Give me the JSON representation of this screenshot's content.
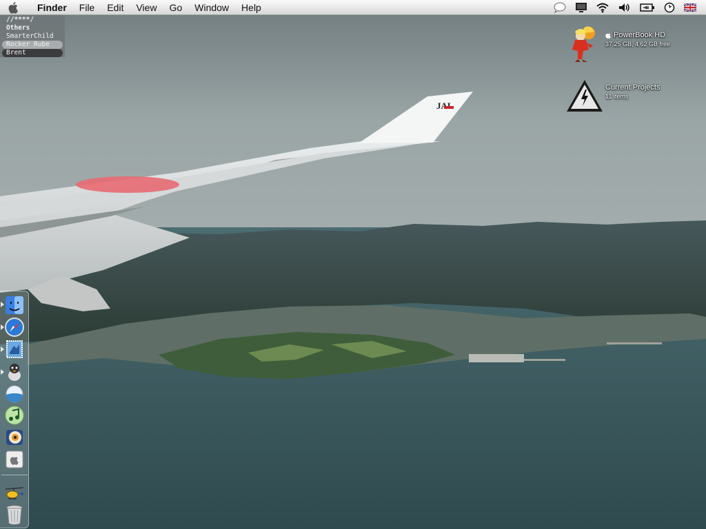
{
  "menubar": {
    "items": [
      "Finder",
      "File",
      "Edit",
      "View",
      "Go",
      "Window",
      "Help"
    ],
    "extras": [
      "speech-bubble-icon",
      "display-icon",
      "wifi-icon",
      "volume-icon",
      "battery-icon",
      "clock-icon",
      "uk-flag-icon"
    ]
  },
  "buddy_list": {
    "lines": [
      {
        "text": "//****/",
        "style": "group"
      },
      {
        "text": "Others",
        "style": "group"
      },
      {
        "text": "SmarterChild",
        "style": "normal"
      },
      {
        "text": "Rocker Rube",
        "style": "selected"
      },
      {
        "text": "Brent",
        "style": "dark"
      }
    ]
  },
  "desktop": {
    "drive": {
      "name": "PowerBook HD",
      "info": "37.25 GB, 4.62 GB free",
      "icon": "character-drive-icon"
    },
    "folder": {
      "name": "Current Projects",
      "info": "11 items",
      "icon": "warning-sign-icon"
    }
  },
  "wallpaper": {
    "wing_logo": "JAL"
  },
  "dock": {
    "items": [
      {
        "name": "finder",
        "icon": "finder-icon",
        "running": true
      },
      {
        "name": "safari",
        "icon": "safari-compass-icon",
        "running": true
      },
      {
        "name": "mail",
        "icon": "mail-stamp-icon",
        "running": true
      },
      {
        "name": "adium",
        "icon": "duck-icon",
        "running": true
      },
      {
        "name": "iTunes-alt",
        "icon": "blue-sphere-icon",
        "running": false
      },
      {
        "name": "itunes",
        "icon": "music-note-icon",
        "running": false
      },
      {
        "name": "quicktime",
        "icon": "speaker-eye-icon",
        "running": false
      },
      {
        "name": "about",
        "icon": "apple-tile-icon",
        "running": false
      }
    ],
    "trash_side": [
      {
        "name": "helicopter",
        "icon": "helicopter-icon"
      },
      {
        "name": "trash",
        "icon": "trash-icon"
      }
    ]
  },
  "colors": {
    "menubar": "#e6e6e6",
    "sea": "#3c5e62",
    "sky": "#8f9c9d",
    "hinomaru": "#e86a73"
  }
}
